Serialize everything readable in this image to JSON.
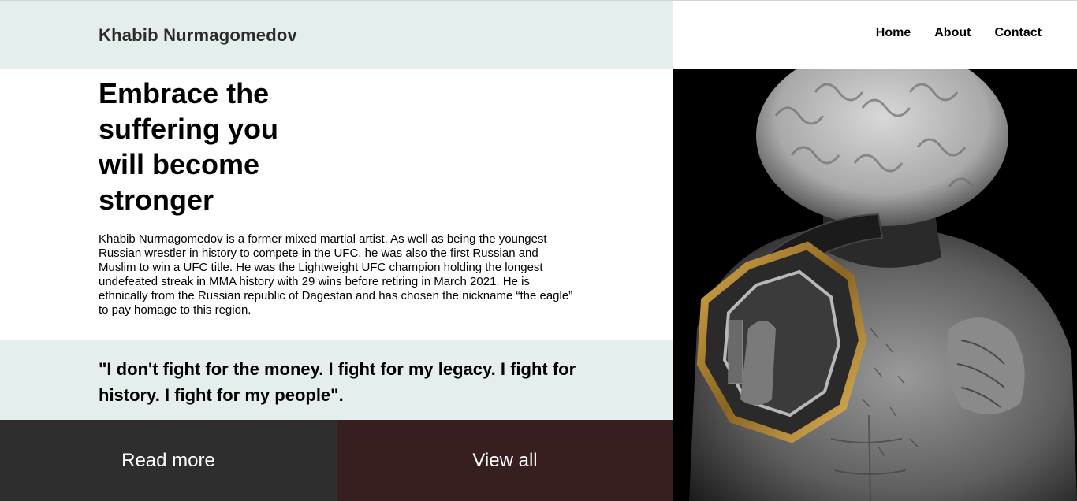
{
  "header": {
    "brand": "Khabib Nurmagomedov"
  },
  "nav": {
    "items": [
      "Home",
      "About",
      "Contact"
    ]
  },
  "hero": {
    "headline": "Embrace the suffering you will become stronger",
    "bio": "Khabib Nurmagomedov is a former mixed martial artist. As well as being the youngest Russian wrestler in history to compete in the UFC, he was also the first Russian and Muslim to win a UFC title. He was the Lightweight UFC champion holding the longest undefeated streak in MMA history with 29 wins before retiring in March 2021. He is ethnically from the Russian republic of Dagestan and has chosen the nickname “the eagle” to pay homage to this region."
  },
  "quote": {
    "text": "\"I don't fight for the money. I fight for my legacy. I fight for history. I fight for my people\"."
  },
  "actions": {
    "read_more": "Read more",
    "view_all": "View all"
  },
  "colors": {
    "header_bg": "#e4eeec",
    "read_more_bg": "#2e2e2e",
    "view_all_bg": "#371f1f"
  },
  "image": {
    "subject": "fighter-with-championship-belt-photo"
  }
}
